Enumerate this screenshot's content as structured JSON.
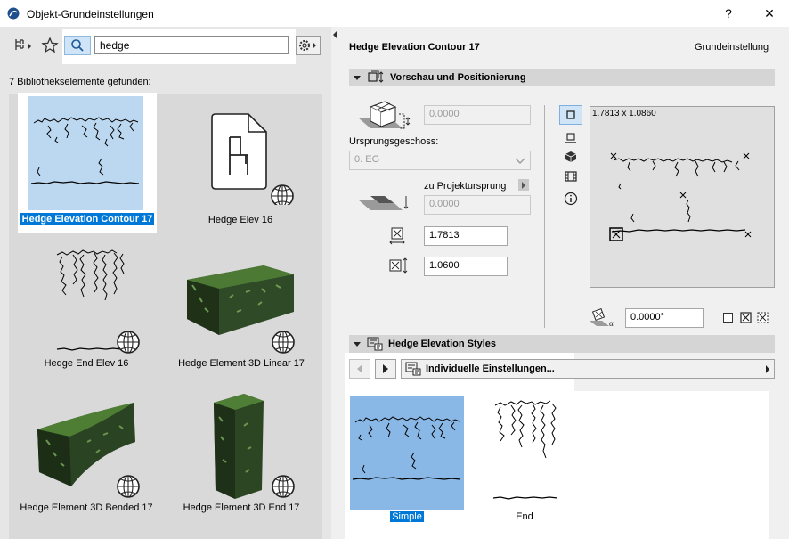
{
  "window": {
    "title": "Objekt-Grundeinstellungen",
    "help_label": "?",
    "close_label": "✕"
  },
  "library": {
    "search_value": "hedge",
    "results_count": "7 Bibliothekselemente gefunden:",
    "items": [
      {
        "label": "Hedge Elevation Contour 17",
        "selected": true
      },
      {
        "label": "Hedge Elev 16",
        "selected": false
      },
      {
        "label": "Hedge End Elev 16",
        "selected": false
      },
      {
        "label": "Hedge Element 3D Linear 17",
        "selected": false
      },
      {
        "label": "Hedge Element 3D Bended 17",
        "selected": false
      },
      {
        "label": "Hedge Element 3D End 17",
        "selected": false
      }
    ]
  },
  "header": {
    "object_name": "Hedge Elevation Contour 17",
    "default_label": "Grundeinstellung"
  },
  "preview_section": {
    "title": "Vorschau und Positionierung",
    "offset_value": "0.0000",
    "story_label": "Ursprungsgeschoss:",
    "story_value": "0. EG",
    "project_origin_label": "zu Projektursprung",
    "project_offset_value": "0.0000",
    "width_value": "1.7813",
    "height_value": "1.0600",
    "preview_dims": "1.7813 x 1.0860",
    "angle_value": "0.0000°"
  },
  "styles_section": {
    "title": "Hedge Elevation Styles",
    "nav_label": "Individuelle Einstellungen...",
    "options": [
      {
        "label": "Simple",
        "selected": true
      },
      {
        "label": "End",
        "selected": false
      }
    ]
  },
  "colors": {
    "accent": "#0078d7",
    "thumb_selected_bg": "#bcd8f1",
    "style_selected_bg": "#8ab8e6"
  }
}
